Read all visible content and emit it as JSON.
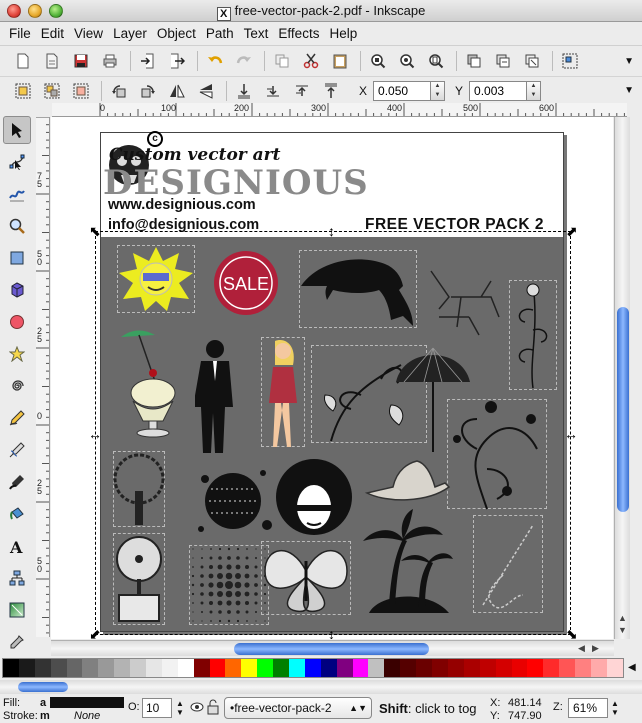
{
  "window": {
    "title": "free-vector-pack-2.pdf - Inkscape"
  },
  "menu": [
    "File",
    "Edit",
    "View",
    "Layer",
    "Object",
    "Path",
    "Text",
    "Effects",
    "Help"
  ],
  "controls": {
    "x_label": "X",
    "x_value": "0.050",
    "y_label": "Y",
    "y_value": "0.003"
  },
  "rulers": {
    "h": [
      "0",
      "100",
      "200",
      "300",
      "400",
      "500",
      "600"
    ],
    "v": [
      "7 5",
      "5 0",
      "2 5",
      "0",
      "2 5",
      "5 0"
    ]
  },
  "document": {
    "header_title": "Custom vector art",
    "logo_text": "DESIGNIOUS",
    "website": "www.designious.com",
    "email": "info@designious.com",
    "pack_title": "FREE VECTOR PACK 2",
    "sale_label": "SALE"
  },
  "palette": [
    "#000000",
    "#1a1a1a",
    "#333333",
    "#4d4d4d",
    "#666666",
    "#808080",
    "#999999",
    "#b3b3b3",
    "#cccccc",
    "#e6e6e6",
    "#f2f2f2",
    "#ffffff",
    "#800000",
    "#ff0000",
    "#ff6600",
    "#ffff00",
    "#00ff00",
    "#008000",
    "#00ffff",
    "#0000ff",
    "#000080",
    "#800080",
    "#ff00ff",
    "#c0c0c0",
    "#3a0000",
    "#550000",
    "#6a0000",
    "#800000",
    "#950000",
    "#aa0000",
    "#bf0000",
    "#d40000",
    "#e90000",
    "#ff0000",
    "#ff2a2a",
    "#ff5555",
    "#ff8080",
    "#ffaaaa",
    "#ffd5d5"
  ],
  "status": {
    "fill_label": "Fill:",
    "fill_value": "a",
    "stroke_label": "Stroke:",
    "stroke_value": "m",
    "stroke_none": "None",
    "opacity_label": "O:",
    "opacity_value": "10",
    "layer_name": "•free-vector-pack-2",
    "message_bold": "Shift",
    "message": ": click to tog",
    "cursor_x_label": "X:",
    "cursor_x": "481.14",
    "cursor_y_label": "Y:",
    "cursor_y": "747.90",
    "zoom_label": "Z:",
    "zoom": "61%"
  }
}
